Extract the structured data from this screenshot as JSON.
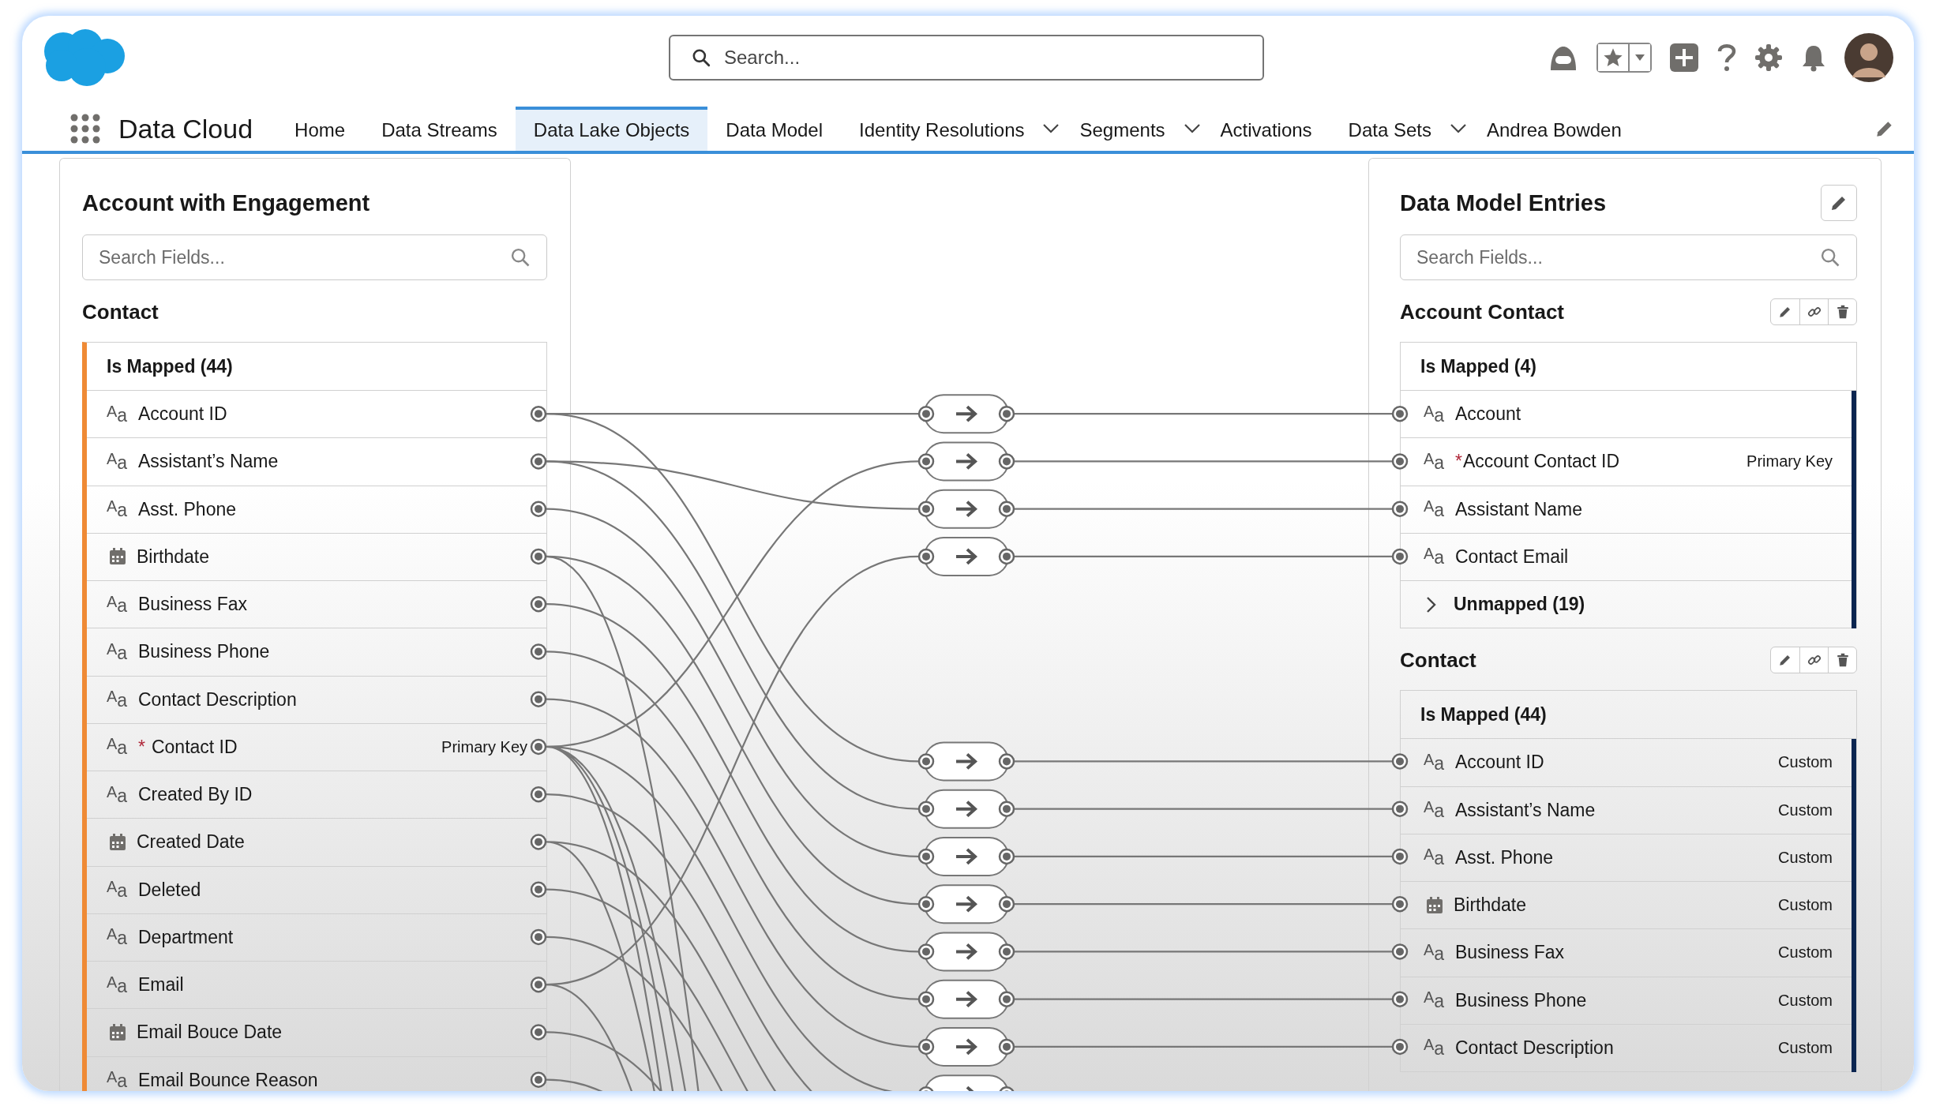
{
  "header": {
    "search_placeholder": "Search..."
  },
  "app_name": "Data Cloud",
  "nav": [
    {
      "label": "Home",
      "selected": false,
      "menu": false
    },
    {
      "label": "Data Streams",
      "selected": false,
      "menu": false
    },
    {
      "label": "Data Lake Objects",
      "selected": true,
      "menu": false
    },
    {
      "label": "Data Model",
      "selected": false,
      "menu": false
    },
    {
      "label": "Identity Resolutions",
      "selected": false,
      "menu": true
    },
    {
      "label": "Segments",
      "selected": false,
      "menu": true
    },
    {
      "label": "Activations",
      "selected": false,
      "menu": false
    },
    {
      "label": "Data Sets",
      "selected": false,
      "menu": true
    },
    {
      "label": "Andrea Bowden",
      "selected": false,
      "menu": false
    }
  ],
  "source": {
    "title": "Account with Engagement",
    "search_placeholder": "Search Fields...",
    "object": "Contact",
    "group": "Is Mapped (44)",
    "fields": [
      {
        "kind": "text",
        "icon": "$^{A}$a",
        "name": "Account ID"
      },
      {
        "kind": "text",
        "icon": "$^{A}$a",
        "name": "Assistant’s Name"
      },
      {
        "kind": "text",
        "icon": "$^{A}$a",
        "name": "Asst. Phone"
      },
      {
        "kind": "date",
        "name": "Birthdate"
      },
      {
        "kind": "text",
        "icon": "$^{A}$a",
        "name": "Business Fax"
      },
      {
        "kind": "text",
        "icon": "$^{A}$a",
        "name": "Business Phone"
      },
      {
        "kind": "text",
        "icon": "$^{A}$a",
        "name": "Contact Description"
      },
      {
        "kind": "text",
        "icon": "$^{A}$a",
        "mark": "*",
        "name": "Contact ID",
        "tag": "Primary Key"
      },
      {
        "kind": "text",
        "icon": "$^{A}$a",
        "name": "Created By ID"
      },
      {
        "kind": "date",
        "name": "Created Date"
      },
      {
        "kind": "text",
        "icon": "$^{A}$a",
        "name": "Deleted"
      },
      {
        "kind": "text",
        "icon": "$^{A}$a",
        "name": "Department"
      },
      {
        "kind": "text",
        "icon": "$^{A}$a",
        "name": "Email"
      },
      {
        "kind": "date",
        "name": "Email Bouce Date"
      },
      {
        "kind": "text",
        "icon": "$^{A}$a",
        "name": "Email Bounce Reason"
      }
    ]
  },
  "target": {
    "title": "Data Model Entries",
    "search_placeholder": "Search Fields...",
    "objects": [
      {
        "name": "Account Contact",
        "group": "Is Mapped (4)",
        "fields": [
          {
            "kind": "text",
            "icon": "$^{A}$a",
            "name": "Account"
          },
          {
            "kind": "text",
            "icon": "$^{A}$a",
            "mark": "*",
            "name": "Account Contact ID",
            "tag": "Primary Key"
          },
          {
            "kind": "text",
            "icon": "$^{A}$a",
            "name": "Assistant Name"
          },
          {
            "kind": "text",
            "icon": "$^{A}$a",
            "name": "Contact Email"
          }
        ],
        "collapsed": {
          "label": "Unmapped (19)",
          "expanded": false
        }
      },
      {
        "name": "Contact",
        "group": "Is Mapped (44)",
        "fields": [
          {
            "kind": "text",
            "icon": "$^{A}$a",
            "name": "Account ID",
            "tag": "Custom"
          },
          {
            "kind": "text",
            "icon": "$^{A}$a",
            "name": "Assistant’s Name",
            "tag": "Custom"
          },
          {
            "kind": "text",
            "icon": "$^{A}$a",
            "name": "Asst. Phone",
            "tag": "Custom"
          },
          {
            "kind": "date",
            "name": "Birthdate",
            "tag": "Custom"
          },
          {
            "kind": "text",
            "icon": "$^{A}$a",
            "name": "Business Fax",
            "tag": "Custom"
          },
          {
            "kind": "text",
            "icon": "$^{A}$a",
            "name": "Business Phone",
            "tag": "Custom"
          },
          {
            "kind": "text",
            "icon": "$^{A}$a",
            "name": "Contact Description",
            "tag": "Custom"
          }
        ]
      }
    ]
  }
}
